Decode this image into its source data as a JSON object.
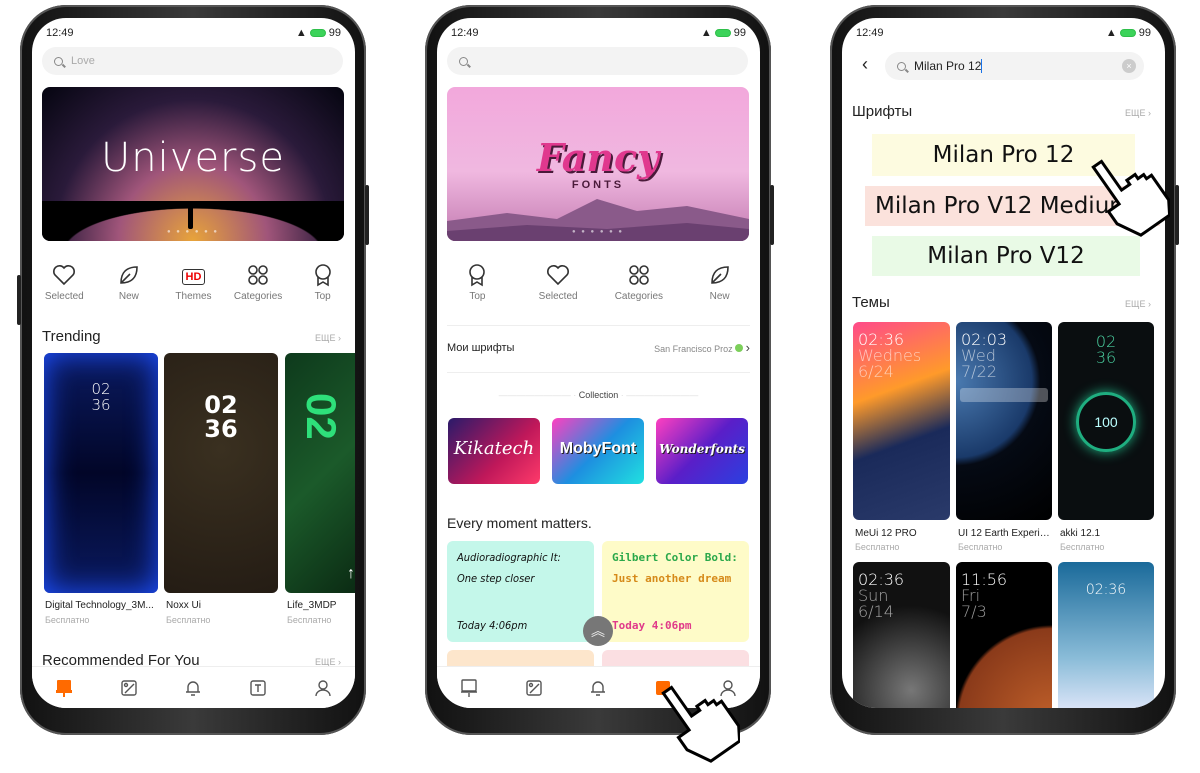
{
  "status": {
    "time": "12:49",
    "battery": "99"
  },
  "phone1": {
    "search_placeholder": "Love",
    "banner_title": "Universe",
    "icons": [
      {
        "label": "Selected",
        "icon": "heart-icon"
      },
      {
        "label": "New",
        "icon": "leaf-icon"
      },
      {
        "label": "Themes",
        "icon": "hd-icon",
        "badge": "HD"
      },
      {
        "label": "Categories",
        "icon": "categories-icon"
      },
      {
        "label": "Top",
        "icon": "medal-icon"
      }
    ],
    "trending": {
      "title": "Trending",
      "more": "ЕЩЕ"
    },
    "themes": [
      {
        "name": "Digital Technology_3M...",
        "price": "Бесплатно",
        "clock": "02\n36"
      },
      {
        "name": "Noxx Ui",
        "price": "Бесплатно",
        "clock": "02\n36"
      },
      {
        "name": "Life_3MDP",
        "price": "Бесплатно",
        "clock": "02"
      }
    ],
    "recommended": {
      "title": "Recommended For You",
      "more": "ЕЩЕ"
    },
    "nav": [
      "themes-icon",
      "wallpaper-icon",
      "ringtone-icon",
      "fonts-icon",
      "profile-icon"
    ],
    "nav_active_color": "#ff6a00"
  },
  "phone2": {
    "search_placeholder": "",
    "banner_title": "Fancy",
    "banner_subtitle": "FONTS",
    "icons": [
      {
        "label": "Top",
        "icon": "medal-icon"
      },
      {
        "label": "Selected",
        "icon": "heart-icon"
      },
      {
        "label": "Categories",
        "icon": "categories-icon"
      },
      {
        "label": "New",
        "icon": "leaf-icon"
      }
    ],
    "my_fonts": {
      "label": "Мои шрифты",
      "value": "San Francisco Proz"
    },
    "collection_label": "Collection",
    "collections": [
      {
        "name": "Kikatech",
        "color": "#c0185a"
      },
      {
        "name": "MobyFont",
        "color": "#1e8fe0"
      },
      {
        "name": "Wonderfonts",
        "color": "#5a1ec8"
      }
    ],
    "moments_title": "Every moment matters.",
    "moment_cards": [
      {
        "line1": "Audioradiographic It:",
        "line2": "One step closer",
        "time": "Today 4:06pm",
        "color": "#c4f7ea"
      },
      {
        "line1": "Gilbert Color Bold:",
        "line2": "Just another dream",
        "time": "Today 4:06pm",
        "color": "#fefbc8"
      }
    ]
  },
  "phone3": {
    "search_value": "Milan Pro 12",
    "fonts": {
      "title": "Шрифты",
      "more": "ЕЩЕ"
    },
    "font_results": [
      {
        "name": "Milan Pro 12",
        "color": "#fdfbe0"
      },
      {
        "name": "Milan Pro V12 Medium",
        "color": "#fbe2dc"
      },
      {
        "name": "Milan Pro V12",
        "color": "#e9fae6"
      }
    ],
    "themes_section": {
      "title": "Темы",
      "more": "ЕЩЕ"
    },
    "themes": [
      {
        "name": "MeUi 12 PRO",
        "price": "Бесплатно",
        "clock": "02:36",
        "day": "Wednes",
        "date": "6/24"
      },
      {
        "name": "UI 12 Earth Experie...",
        "price": "Бесплатно",
        "clock": "02:03",
        "day": "Wed",
        "date": "7/22"
      },
      {
        "name": "akki 12.1",
        "price": "Бесплатно",
        "clock": "02\n36",
        "charge": "100"
      },
      {
        "clock": "02:36",
        "day": "Sun",
        "date": "6/14"
      },
      {
        "clock": "11:56",
        "day": "Fri",
        "date": "7/3"
      },
      {
        "clock": "02:36"
      }
    ]
  }
}
